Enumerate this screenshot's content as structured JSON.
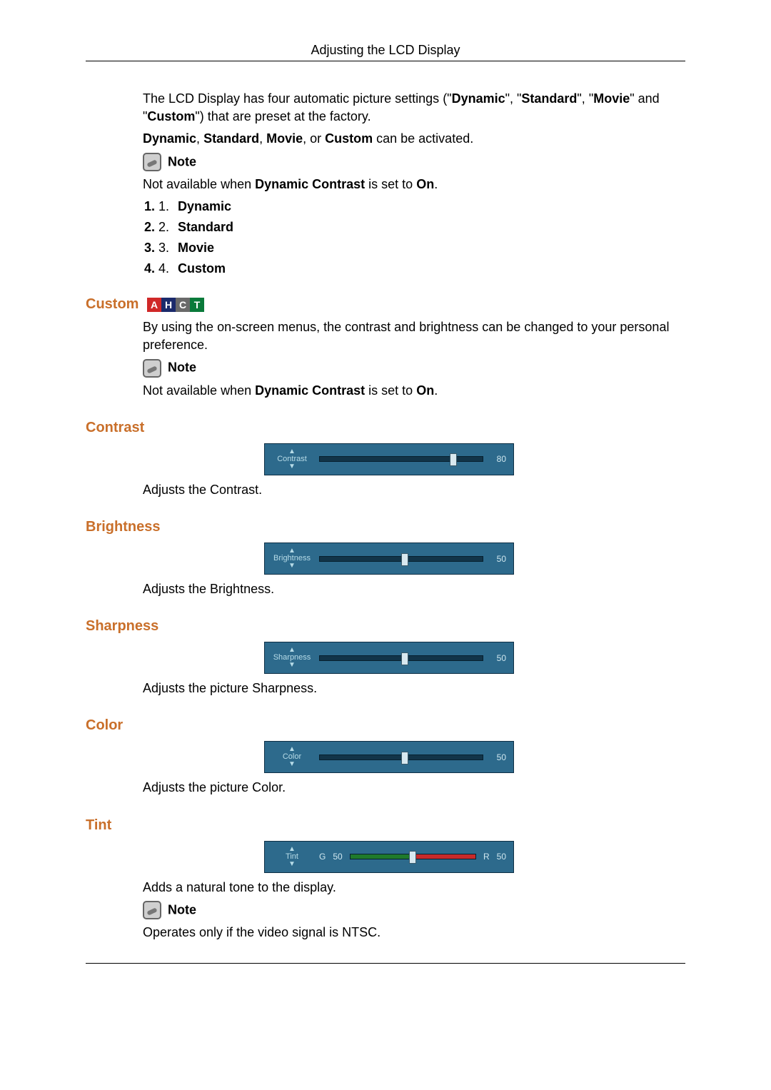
{
  "header": {
    "title": "Adjusting the LCD Display"
  },
  "intro": {
    "p1a": "The LCD Display has four automatic picture settings (\"",
    "p1b": "\", \"",
    "p1c": "\", \"",
    "p1d": "\" and \"",
    "p1e": "\") that are preset at the factory.",
    "m1": "Dynamic",
    "m2": "Standard",
    "m3": "Movie",
    "m4": "Custom",
    "p2a": "Dynamic",
    "p2b": ", ",
    "p2c": "Standard",
    "p2d": ", ",
    "p2e": "Movie",
    "p2f": ", or ",
    "p2g": "Custom",
    "p2h": " can be activated.",
    "noteLabel": "Note",
    "noteTextA": "Not available when ",
    "noteTextB": "Dynamic Contrast",
    "noteTextC": " is set to ",
    "noteTextD": "On",
    "noteTextE": "."
  },
  "modes": {
    "n1": "1.",
    "n2": "2.",
    "n3": "3.",
    "n4": "4.",
    "l1": "Dynamic",
    "l2": "Standard",
    "l3": "Movie",
    "l4": "Custom"
  },
  "customSection": {
    "title": "Custom",
    "badges": {
      "a": "A",
      "h": "H",
      "c": "C",
      "t": "T"
    },
    "desc": "By using the on-screen menus, the contrast and brightness can be changed to your personal preference.",
    "noteLabel": "Note",
    "noteTextA": "Not available when ",
    "noteTextB": "Dynamic Contrast",
    "noteTextC": " is set to ",
    "noteTextD": "On",
    "noteTextE": "."
  },
  "sliders": {
    "contrast": {
      "title": "Contrast",
      "label": "Contrast",
      "value": "80",
      "pct": 80,
      "desc": "Adjusts the Contrast."
    },
    "brightness": {
      "title": "Brightness",
      "label": "Brightness",
      "value": "50",
      "pct": 50,
      "desc": "Adjusts the Brightness."
    },
    "sharpness": {
      "title": "Sharpness",
      "label": "Sharpness",
      "value": "50",
      "pct": 50,
      "desc": "Adjusts the picture Sharpness."
    },
    "color": {
      "title": "Color",
      "label": "Color",
      "value": "50",
      "pct": 50,
      "desc": "Adjusts the picture Color."
    },
    "tint": {
      "title": "Tint",
      "label": "Tint",
      "g": "G",
      "gval": "50",
      "r": "R",
      "rval": "50",
      "desc": "Adds a natural tone to the display.",
      "noteLabel": "Note",
      "noteText": "Operates only if the video signal is NTSC."
    }
  }
}
